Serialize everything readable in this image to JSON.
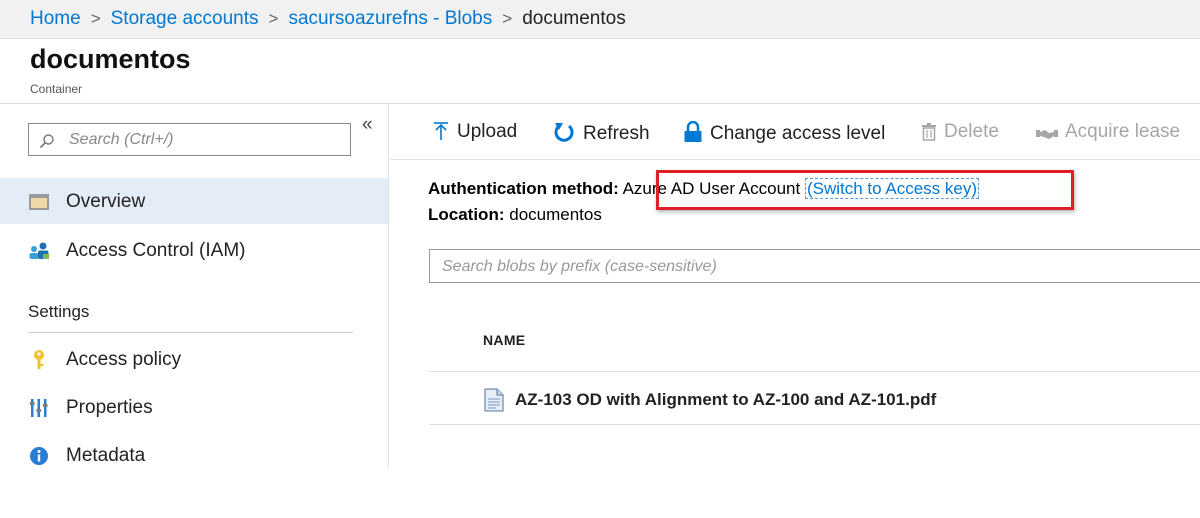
{
  "breadcrumb": {
    "items": [
      "Home",
      "Storage accounts",
      "sacursoazurefns - Blobs"
    ],
    "current": "documentos",
    "separator": ">"
  },
  "page": {
    "title": "documentos",
    "subtitle": "Container"
  },
  "sidebar": {
    "search_placeholder": "Search (Ctrl+/)",
    "collapse_glyph": "«",
    "items": [
      {
        "label": "Overview",
        "icon": "overview-icon",
        "selected": true
      },
      {
        "label": "Access Control (IAM)",
        "icon": "people-icon"
      }
    ],
    "settings_heading": "Settings",
    "settings_items": [
      {
        "label": "Access policy",
        "icon": "key-icon"
      },
      {
        "label": "Properties",
        "icon": "properties-icon"
      },
      {
        "label": "Metadata",
        "icon": "info-icon"
      }
    ]
  },
  "toolbar": {
    "upload": "Upload",
    "refresh": "Refresh",
    "change_access": "Change access level",
    "delete": "Delete",
    "acquire_lease": "Acquire lease"
  },
  "info": {
    "auth_label": "Authentication method:",
    "auth_value": "Azure AD User Account",
    "switch_link": "(Switch to Access key)",
    "location_label": "Location:",
    "location_value": "documentos"
  },
  "blob_search": {
    "placeholder": "Search blobs by prefix (case-sensitive)"
  },
  "table": {
    "columns": [
      "NAME"
    ],
    "rows": [
      {
        "name": "AZ-103 OD with Alignment to AZ-100 and AZ-101.pdf",
        "icon": "document-icon"
      }
    ]
  },
  "colors": {
    "accent": "#0078d4",
    "selected_bg": "#e4edf7",
    "highlight": "#e01e25"
  }
}
